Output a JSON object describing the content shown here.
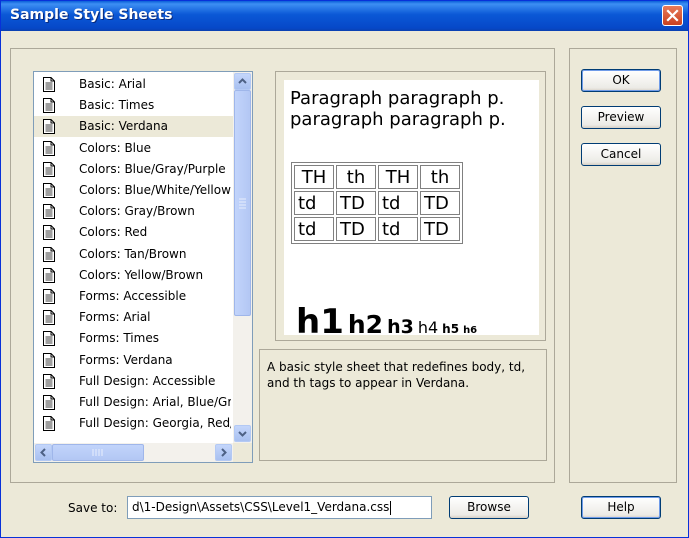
{
  "window": {
    "title": "Sample Style Sheets"
  },
  "stylesheets": {
    "items": [
      {
        "label": "Basic: Arial"
      },
      {
        "label": "Basic: Times"
      },
      {
        "label": "Basic: Verdana",
        "selected": true
      },
      {
        "label": "Colors: Blue"
      },
      {
        "label": "Colors: Blue/Gray/Purple"
      },
      {
        "label": "Colors: Blue/White/Yellow"
      },
      {
        "label": "Colors: Gray/Brown"
      },
      {
        "label": "Colors: Red"
      },
      {
        "label": "Colors: Tan/Brown"
      },
      {
        "label": "Colors: Yellow/Brown"
      },
      {
        "label": "Forms: Accessible"
      },
      {
        "label": "Forms: Arial"
      },
      {
        "label": "Forms: Times"
      },
      {
        "label": "Forms: Verdana"
      },
      {
        "label": "Full Design: Accessible"
      },
      {
        "label": "Full Design: Arial, Blue/Gray"
      },
      {
        "label": "Full Design: Georgia, Red/Yellow"
      }
    ]
  },
  "preview": {
    "paragraph_line1": "Paragraph paragraph p.",
    "paragraph_line2": "paragraph paragraph p.",
    "table": {
      "header": [
        "TH",
        "th",
        "TH",
        "th"
      ],
      "rows": [
        [
          "td",
          "TD",
          "td",
          "TD"
        ],
        [
          "td",
          "TD",
          "td",
          "TD"
        ]
      ]
    },
    "headings": {
      "h1": "h1",
      "h2": "h2",
      "h3": "h3",
      "h4": "h4",
      "h5": "h5",
      "h6": "h6"
    }
  },
  "description": "A basic style sheet that redefines body, td, and th tags to appear in Verdana.",
  "buttons": {
    "ok": "OK",
    "preview": "Preview",
    "cancel": "Cancel",
    "browse": "Browse",
    "help": "Help"
  },
  "save": {
    "label": "Save to:",
    "path": "d\\1-Design\\Assets\\CSS\\Level1_Verdana.css"
  },
  "icons": {
    "list_item": "document-icon",
    "close": "close-icon"
  }
}
